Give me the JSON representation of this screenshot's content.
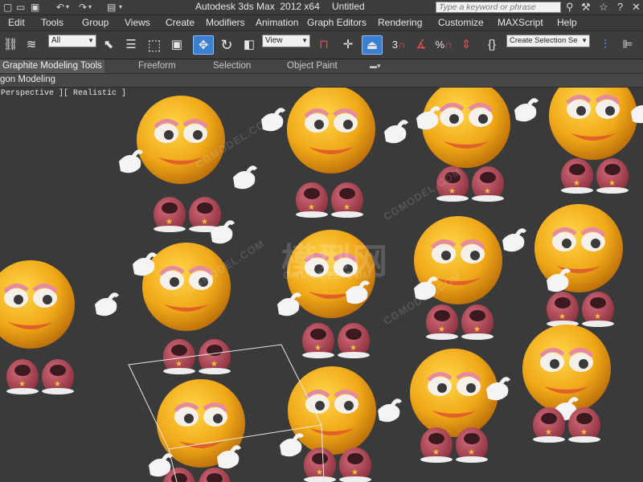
{
  "titlebar": {
    "app_title": "Autodesk 3ds Max  2012 x64",
    "doc_title": "Untitled",
    "search_placeholder": "Type a keyword or phrase"
  },
  "menubar": [
    "Edit",
    "Tools",
    "Group",
    "Views",
    "Create",
    "Modifiers",
    "Animation",
    "Graph Editors",
    "Rendering",
    "Customize",
    "MAXScript",
    "Help"
  ],
  "toolbar": {
    "filter_value": "All",
    "ref_coord_value": "View",
    "named_selection_value": "Create Selection Se",
    "snap_labels": [
      "3",
      "%"
    ],
    "accent": "#3b7fd0"
  },
  "ribbon": {
    "tabs": [
      "Graphite Modeling Tools",
      "Freeform",
      "Selection",
      "Object Paint"
    ],
    "sub_label": "gon Modeling"
  },
  "viewport": {
    "label": "Perspective ][ Realistic ]",
    "watermarks": [
      "CGMODEL.COM",
      "CGMODEL.COM",
      "CGMODEL.COM",
      "CGMODEL.COM"
    ],
    "logo_text": "模型网",
    "logo_sub": "CGMODEL.COM"
  },
  "icons": [
    "link-icon",
    "unlink-icon",
    "select-object-icon",
    "select-by-name-icon",
    "rectangle-selection-icon",
    "window-crossing-icon",
    "select-move-icon",
    "select-rotate-icon",
    "select-scale-icon",
    "pivot-icon",
    "manipulate-icon",
    "keyboard-shortcut-icon",
    "snap-toggle-icon",
    "angle-snap-icon",
    "percent-snap-icon",
    "spinner-snap-icon",
    "edit-named-sets-icon",
    "mirror-icon",
    "help-icon",
    "tools-icon",
    "star-icon",
    "close-icon"
  ]
}
